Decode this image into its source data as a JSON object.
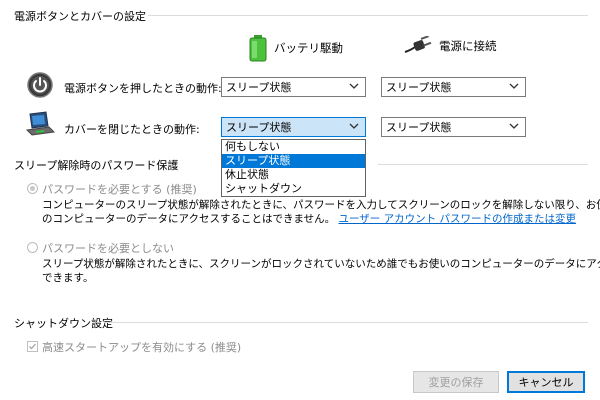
{
  "power_section": {
    "title": "電源ボタンとカバーの設定",
    "col_battery": "バッテリ駆動",
    "col_plugged": "電源に接続",
    "rows": [
      {
        "label": "電源ボタンを押したときの動作:",
        "battery": "スリープ状態",
        "plugged": "スリープ状態"
      },
      {
        "label": "カバーを閉じたときの動作:",
        "battery": "スリープ状態",
        "plugged": "スリープ状態"
      }
    ],
    "dropdown_options": [
      "何もしない",
      "スリープ状態",
      "休止状態",
      "シャットダウン"
    ]
  },
  "password_section": {
    "title": "スリープ解除時のパスワード保護",
    "require": {
      "label": "パスワードを必要とする (推奨)",
      "desc_line1": "コンピューターのスリープ状態が解除されたときに、パスワードを入力してスクリーンのロックを解除しない限り、お使い",
      "desc_line2": "のコンピューターのデータにアクセスすることはできません。",
      "link": "ユーザー アカウント パスワードの作成または変更"
    },
    "not_require": {
      "label": "パスワードを必要としない",
      "desc_line1": "スリープ状態が解除されたときに、スクリーンがロックされていないため誰でもお使いのコンピューターのデータにアクセス",
      "desc_line2": "できます。"
    }
  },
  "shutdown_section": {
    "title": "シャットダウン設定",
    "fast_startup": "高速スタートアップを有効にする (推奨)"
  },
  "buttons": {
    "save": "変更の保存",
    "cancel": "キャンセル"
  }
}
